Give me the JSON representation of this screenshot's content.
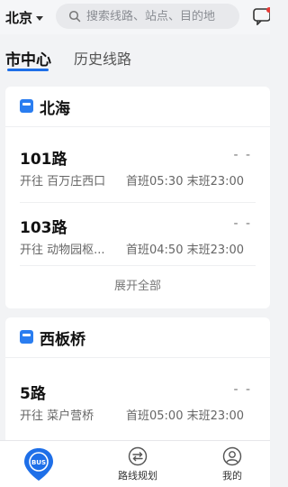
{
  "header": {
    "city": "北京",
    "search_placeholder": "搜索线路、站点、目的地"
  },
  "tabs": [
    {
      "label": "市中心",
      "active": true
    },
    {
      "label": "历史线路",
      "active": false
    }
  ],
  "stops": [
    {
      "name": "北海",
      "routes": [
        {
          "number": "101路",
          "eta": "- -",
          "direction": "开往 百万庄西口",
          "times": "首班05:30 末班23:00"
        },
        {
          "number": "103路",
          "eta": "- -",
          "direction": "开往 动物园枢...",
          "times": "首班04:50 末班23:00"
        }
      ],
      "expand_label": "展开全部"
    },
    {
      "name": "西板桥",
      "routes": [
        {
          "number": "5路",
          "eta": "- -",
          "direction": "开往 菜户营桥",
          "times": "首班05:00 末班23:00"
        }
      ]
    }
  ],
  "bottom_nav": {
    "bus_badge": "BUS",
    "route_label": "路线规划",
    "mine_label": "我的"
  },
  "colors": {
    "accent": "#1e6fe8",
    "stop_icon": "#2a7df0"
  }
}
